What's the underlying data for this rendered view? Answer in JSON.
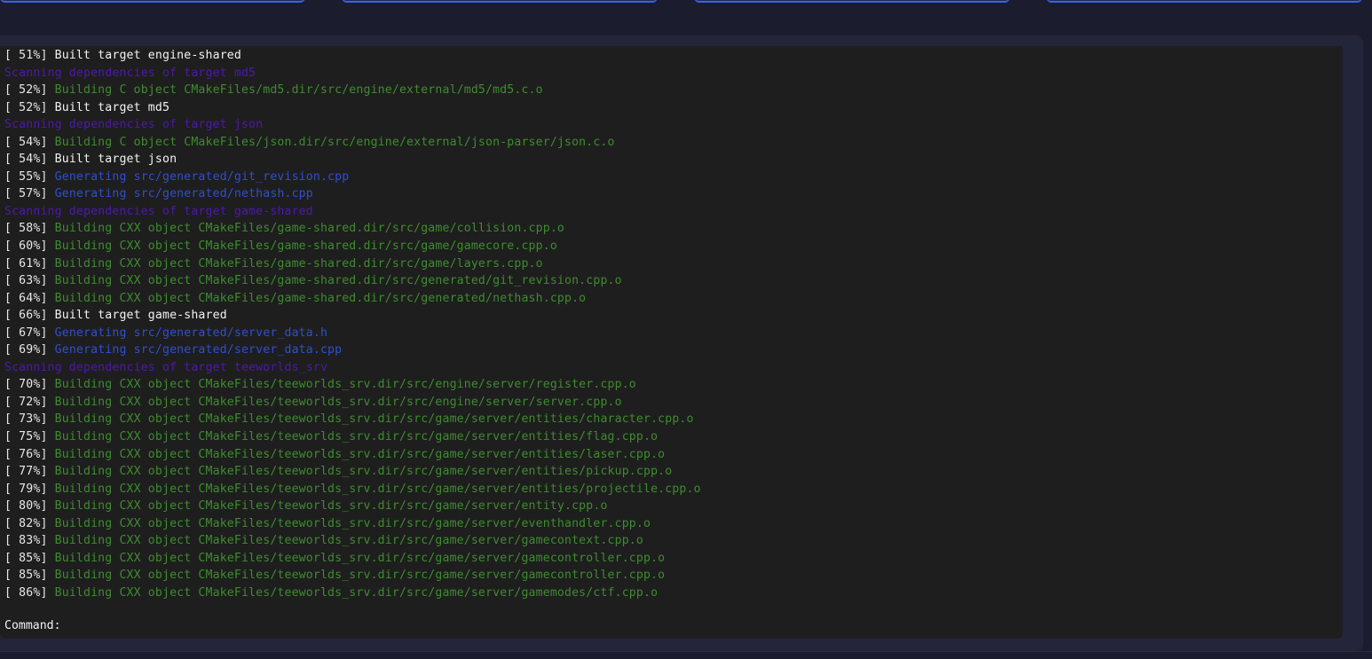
{
  "top_tabs": [
    {
      "name": "tab-1"
    },
    {
      "name": "tab-2"
    },
    {
      "name": "tab-3"
    },
    {
      "name": "tab-4"
    }
  ],
  "terminal": {
    "lines": [
      {
        "pct": "[ 51%] ",
        "type": "built",
        "text": "Built target engine-shared"
      },
      {
        "pct": "",
        "type": "scanning",
        "text": "Scanning dependencies of target md5"
      },
      {
        "pct": "[ 52%] ",
        "type": "building",
        "text": "Building C object CMakeFiles/md5.dir/src/engine/external/md5/md5.c.o"
      },
      {
        "pct": "[ 52%] ",
        "type": "built",
        "text": "Built target md5"
      },
      {
        "pct": "",
        "type": "scanning",
        "text": "Scanning dependencies of target json"
      },
      {
        "pct": "[ 54%] ",
        "type": "building",
        "text": "Building C object CMakeFiles/json.dir/src/engine/external/json-parser/json.c.o"
      },
      {
        "pct": "[ 54%] ",
        "type": "built",
        "text": "Built target json"
      },
      {
        "pct": "[ 55%] ",
        "type": "generating",
        "text": "Generating src/generated/git_revision.cpp"
      },
      {
        "pct": "[ 57%] ",
        "type": "generating",
        "text": "Generating src/generated/nethash.cpp"
      },
      {
        "pct": "",
        "type": "scanning",
        "text": "Scanning dependencies of target game-shared"
      },
      {
        "pct": "[ 58%] ",
        "type": "building",
        "text": "Building CXX object CMakeFiles/game-shared.dir/src/game/collision.cpp.o"
      },
      {
        "pct": "[ 60%] ",
        "type": "building",
        "text": "Building CXX object CMakeFiles/game-shared.dir/src/game/gamecore.cpp.o"
      },
      {
        "pct": "[ 61%] ",
        "type": "building",
        "text": "Building CXX object CMakeFiles/game-shared.dir/src/game/layers.cpp.o"
      },
      {
        "pct": "[ 63%] ",
        "type": "building",
        "text": "Building CXX object CMakeFiles/game-shared.dir/src/generated/git_revision.cpp.o"
      },
      {
        "pct": "[ 64%] ",
        "type": "building",
        "text": "Building CXX object CMakeFiles/game-shared.dir/src/generated/nethash.cpp.o"
      },
      {
        "pct": "[ 66%] ",
        "type": "built",
        "text": "Built target game-shared"
      },
      {
        "pct": "[ 67%] ",
        "type": "generating",
        "text": "Generating src/generated/server_data.h"
      },
      {
        "pct": "[ 69%] ",
        "type": "generating",
        "text": "Generating src/generated/server_data.cpp"
      },
      {
        "pct": "",
        "type": "scanning",
        "text": "Scanning dependencies of target teeworlds_srv"
      },
      {
        "pct": "[ 70%] ",
        "type": "building",
        "text": "Building CXX object CMakeFiles/teeworlds_srv.dir/src/engine/server/register.cpp.o"
      },
      {
        "pct": "[ 72%] ",
        "type": "building",
        "text": "Building CXX object CMakeFiles/teeworlds_srv.dir/src/engine/server/server.cpp.o"
      },
      {
        "pct": "[ 73%] ",
        "type": "building",
        "text": "Building CXX object CMakeFiles/teeworlds_srv.dir/src/game/server/entities/character.cpp.o"
      },
      {
        "pct": "[ 75%] ",
        "type": "building",
        "text": "Building CXX object CMakeFiles/teeworlds_srv.dir/src/game/server/entities/flag.cpp.o"
      },
      {
        "pct": "[ 76%] ",
        "type": "building",
        "text": "Building CXX object CMakeFiles/teeworlds_srv.dir/src/game/server/entities/laser.cpp.o"
      },
      {
        "pct": "[ 77%] ",
        "type": "building",
        "text": "Building CXX object CMakeFiles/teeworlds_srv.dir/src/game/server/entities/pickup.cpp.o"
      },
      {
        "pct": "[ 79%] ",
        "type": "building",
        "text": "Building CXX object CMakeFiles/teeworlds_srv.dir/src/game/server/entities/projectile.cpp.o"
      },
      {
        "pct": "[ 80%] ",
        "type": "building",
        "text": "Building CXX object CMakeFiles/teeworlds_srv.dir/src/game/server/entity.cpp.o"
      },
      {
        "pct": "[ 82%] ",
        "type": "building",
        "text": "Building CXX object CMakeFiles/teeworlds_srv.dir/src/game/server/eventhandler.cpp.o"
      },
      {
        "pct": "[ 83%] ",
        "type": "building",
        "text": "Building CXX object CMakeFiles/teeworlds_srv.dir/src/game/server/gamecontext.cpp.o"
      },
      {
        "pct": "[ 85%] ",
        "type": "building",
        "text": "Building CXX object CMakeFiles/teeworlds_srv.dir/src/game/server/gamecontroller.cpp.o"
      },
      {
        "pct": "[ 85%] ",
        "type": "building",
        "text": "Building CXX object CMakeFiles/teeworlds_srv.dir/src/game/server/gamecontroller.cpp.o"
      },
      {
        "pct": "[ 86%] ",
        "type": "building",
        "text": "Building CXX object CMakeFiles/teeworlds_srv.dir/src/game/server/gamemodes/ctf.cpp.o"
      }
    ],
    "command_label": "Command:",
    "command_value": ""
  },
  "colors": {
    "built": "#f2f2f2",
    "building": "#3e8c2f",
    "generating": "#2f4fcf",
    "scanning": "#4d1aa8",
    "scrollbar": "#3d7be8"
  }
}
